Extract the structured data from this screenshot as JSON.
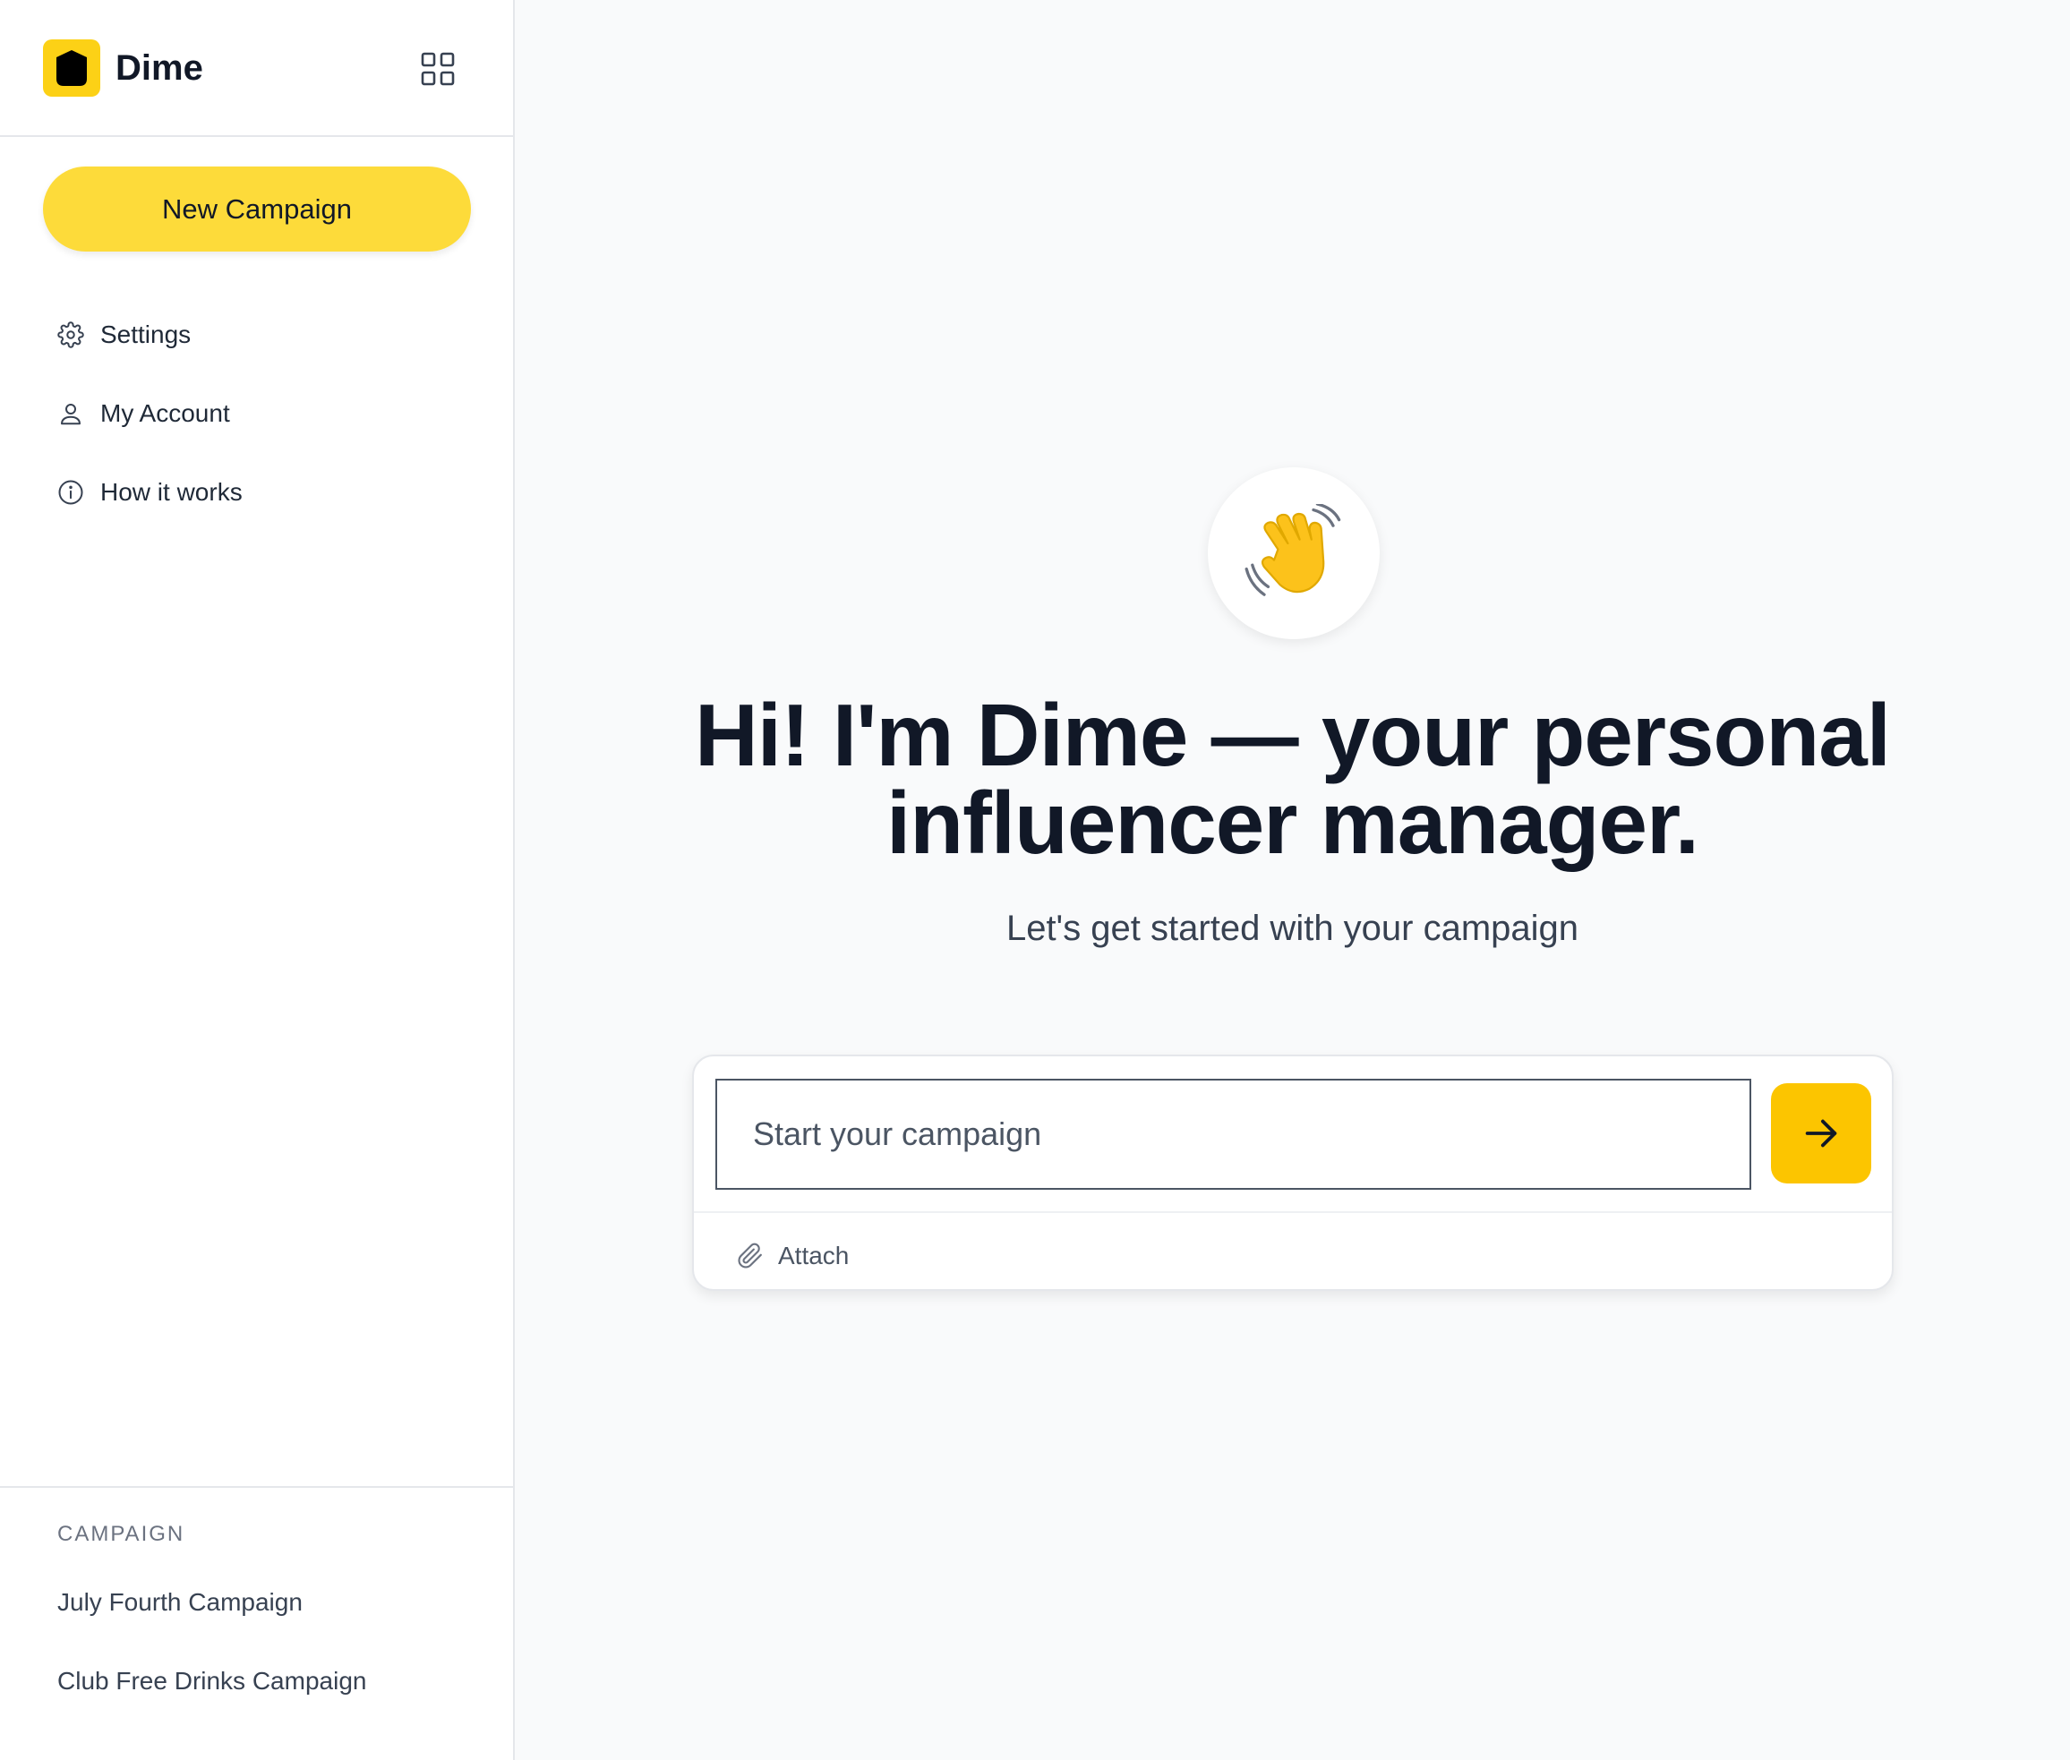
{
  "app": {
    "name": "Dime"
  },
  "sidebar": {
    "new_campaign_label": "New Campaign",
    "nav": [
      {
        "label": "Settings",
        "icon": "gear-icon"
      },
      {
        "label": "My Account",
        "icon": "user-icon"
      },
      {
        "label": "How it works",
        "icon": "info-icon"
      }
    ],
    "campaign_section": {
      "title": "CAMPAIGN",
      "items": [
        "July Fourth Campaign",
        "Club Free Drinks Campaign"
      ]
    }
  },
  "main": {
    "emoji": "👋",
    "headline_line1": "Hi! I'm Dime — your personal",
    "headline_line2": "influencer manager.",
    "subheading": "Let's get started with your campaign",
    "composer": {
      "placeholder": "Start your campaign",
      "value": "",
      "attach_label": "Attach"
    }
  },
  "colors": {
    "brand_yellow": "#fcd116",
    "button_yellow": "#fddb3a",
    "send_yellow": "#fcc500",
    "background": "#f9fafb",
    "text_dark": "#111827"
  }
}
